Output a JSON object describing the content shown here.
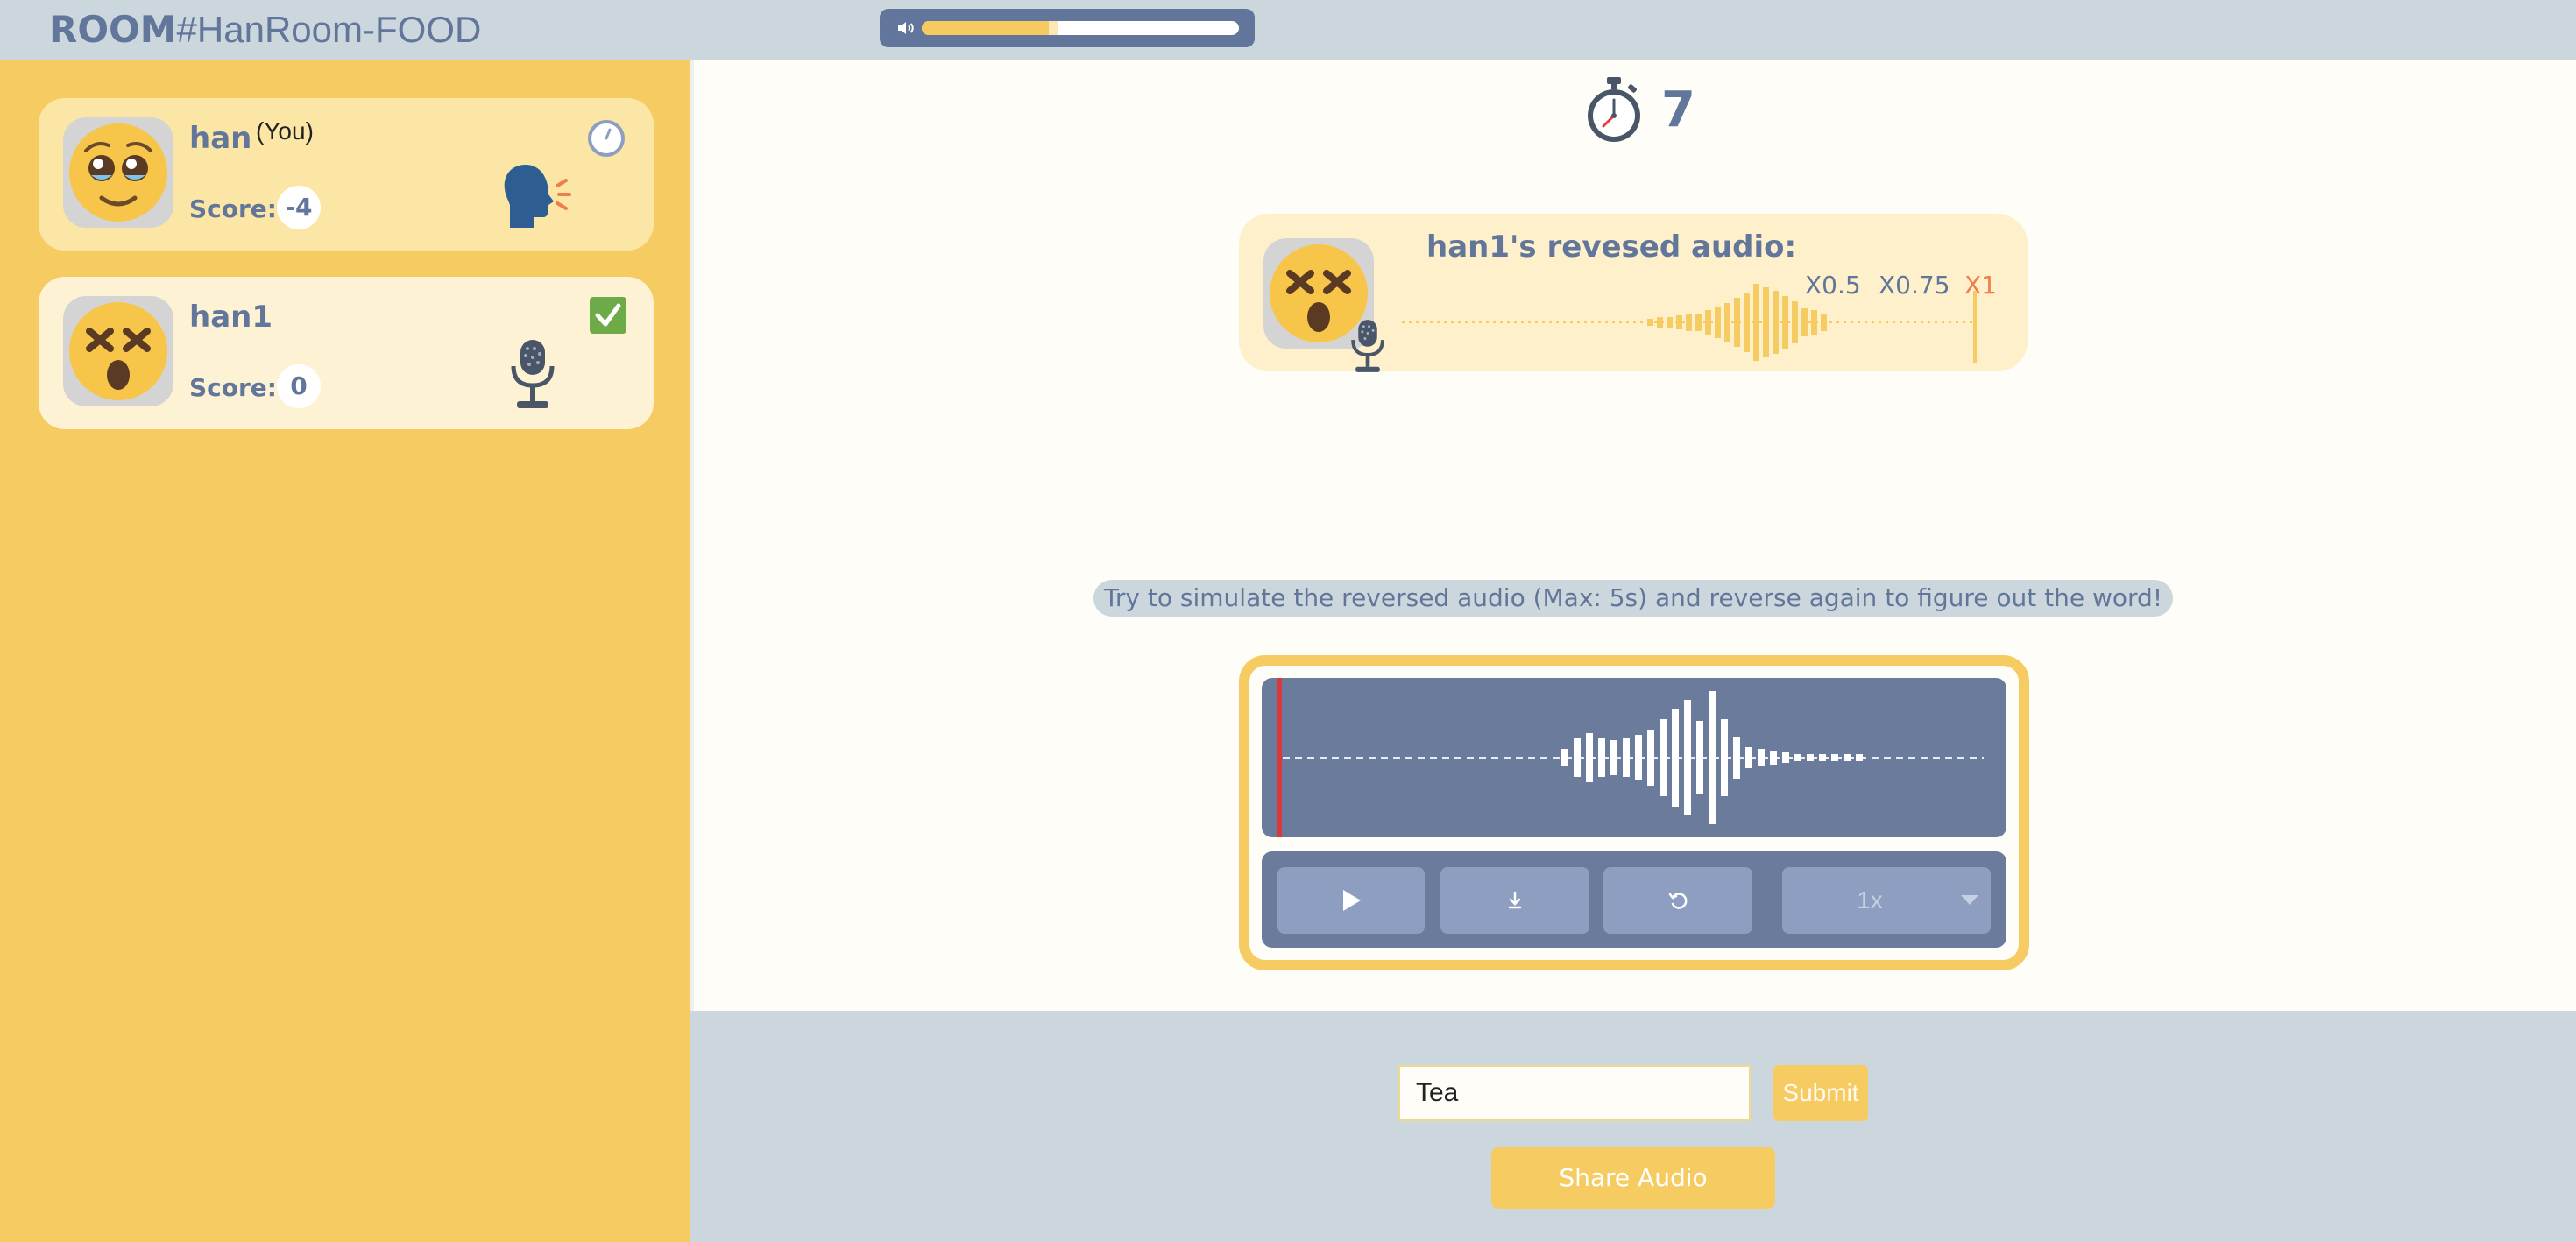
{
  "header": {
    "room_prefix": "ROOM",
    "room_name": "#HanRoom-FOOD",
    "volume": {
      "level": 0.4,
      "buffered": 0.43
    }
  },
  "players": [
    {
      "name": "han",
      "tag": "(You)",
      "score_label": "Score:",
      "score": "-4",
      "status_icon": "clock-icon",
      "role_icon": "speaking-head-icon"
    },
    {
      "name": "han1",
      "tag": "",
      "score_label": "Score:",
      "score": "0",
      "status_icon": "checkmark-icon",
      "role_icon": "microphone-icon"
    }
  ],
  "timer": {
    "count": "7"
  },
  "reversed_audio": {
    "title": "han1's revesed audio:",
    "speeds": [
      "X0.5",
      "X0.75",
      "X1"
    ],
    "selected_speed": "X1"
  },
  "instruction": "Try to simulate the reversed audio (Max: 5s) and reverse again to figure out the word!",
  "recorder": {
    "playback_rate": "1x",
    "buttons": [
      "play",
      "download",
      "reset"
    ]
  },
  "answer": {
    "value": "Tea",
    "submit_label": "Submit"
  },
  "share_label": "Share Audio",
  "colors": {
    "accent": "#f6cc62",
    "primary": "#62759a",
    "wave_bg": "#6b7b9c",
    "highlight": "#ef7d4d"
  }
}
